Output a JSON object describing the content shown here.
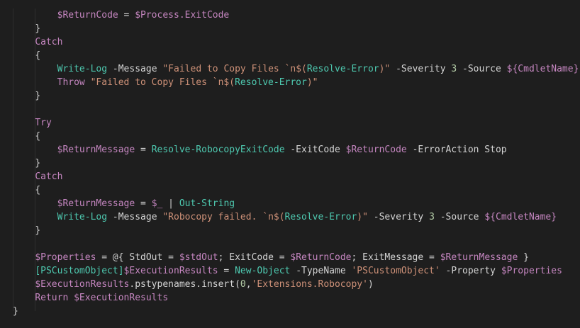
{
  "editor": {
    "colors": {
      "background": "#1e1e1e",
      "variable": "#c586c0",
      "keyword": "#c586c0",
      "function": "#4ec9b0",
      "string": "#ce9178",
      "operator": "#d4d4d4",
      "number": "#b5cea8",
      "plain": "#d4d4d4"
    },
    "lines": [
      {
        "indent": "        ",
        "tokens": [
          {
            "t": "var",
            "v": "$ReturnCode"
          },
          {
            "t": "op",
            "v": " = "
          },
          {
            "t": "var",
            "v": "$Process.ExitCode"
          }
        ]
      },
      {
        "indent": "    ",
        "tokens": [
          {
            "t": "plain",
            "v": "}"
          }
        ]
      },
      {
        "indent": "    ",
        "tokens": [
          {
            "t": "kw",
            "v": "Catch"
          }
        ]
      },
      {
        "indent": "    ",
        "tokens": [
          {
            "t": "plain",
            "v": "{"
          }
        ]
      },
      {
        "indent": "        ",
        "tokens": [
          {
            "t": "fn",
            "v": "Write-Log"
          },
          {
            "t": "plain",
            "v": " "
          },
          {
            "t": "op",
            "v": "-Message"
          },
          {
            "t": "plain",
            "v": " "
          },
          {
            "t": "str",
            "v": "\"Failed to Copy Files `n$("
          },
          {
            "t": "fn",
            "v": "Resolve-Error"
          },
          {
            "t": "str",
            "v": ")\""
          },
          {
            "t": "plain",
            "v": " "
          },
          {
            "t": "op",
            "v": "-Severity"
          },
          {
            "t": "plain",
            "v": " "
          },
          {
            "t": "num",
            "v": "3"
          },
          {
            "t": "plain",
            "v": " "
          },
          {
            "t": "op",
            "v": "-Source"
          },
          {
            "t": "plain",
            "v": " "
          },
          {
            "t": "var",
            "v": "${CmdletName}"
          }
        ]
      },
      {
        "indent": "        ",
        "tokens": [
          {
            "t": "kw",
            "v": "Throw"
          },
          {
            "t": "plain",
            "v": " "
          },
          {
            "t": "str",
            "v": "\"Failed to Copy Files `n$("
          },
          {
            "t": "fn",
            "v": "Resolve-Error"
          },
          {
            "t": "str",
            "v": ")\""
          }
        ]
      },
      {
        "indent": "    ",
        "tokens": [
          {
            "t": "plain",
            "v": "}"
          }
        ]
      },
      {
        "indent": "",
        "tokens": []
      },
      {
        "indent": "    ",
        "tokens": [
          {
            "t": "kw",
            "v": "Try"
          }
        ]
      },
      {
        "indent": "    ",
        "tokens": [
          {
            "t": "plain",
            "v": "{"
          }
        ]
      },
      {
        "indent": "        ",
        "tokens": [
          {
            "t": "var",
            "v": "$ReturnMessage"
          },
          {
            "t": "op",
            "v": " = "
          },
          {
            "t": "fn",
            "v": "Resolve-RobocopyExitCode"
          },
          {
            "t": "plain",
            "v": " "
          },
          {
            "t": "op",
            "v": "-ExitCode"
          },
          {
            "t": "plain",
            "v": " "
          },
          {
            "t": "var",
            "v": "$ReturnCode"
          },
          {
            "t": "plain",
            "v": " "
          },
          {
            "t": "op",
            "v": "-ErrorAction"
          },
          {
            "t": "plain",
            "v": " Stop"
          }
        ]
      },
      {
        "indent": "    ",
        "tokens": [
          {
            "t": "plain",
            "v": "}"
          }
        ]
      },
      {
        "indent": "    ",
        "tokens": [
          {
            "t": "kw",
            "v": "Catch"
          }
        ]
      },
      {
        "indent": "    ",
        "tokens": [
          {
            "t": "plain",
            "v": "{"
          }
        ]
      },
      {
        "indent": "        ",
        "tokens": [
          {
            "t": "var",
            "v": "$ReturnMessage"
          },
          {
            "t": "op",
            "v": " = "
          },
          {
            "t": "var",
            "v": "$_"
          },
          {
            "t": "plain",
            "v": " "
          },
          {
            "t": "op",
            "v": "|"
          },
          {
            "t": "plain",
            "v": " "
          },
          {
            "t": "fn",
            "v": "Out-String"
          }
        ]
      },
      {
        "indent": "        ",
        "tokens": [
          {
            "t": "fn",
            "v": "Write-Log"
          },
          {
            "t": "plain",
            "v": " "
          },
          {
            "t": "op",
            "v": "-Message"
          },
          {
            "t": "plain",
            "v": " "
          },
          {
            "t": "str",
            "v": "\"Robocopy failed. `n$("
          },
          {
            "t": "fn",
            "v": "Resolve-Error"
          },
          {
            "t": "str",
            "v": ")\""
          },
          {
            "t": "plain",
            "v": " "
          },
          {
            "t": "op",
            "v": "-Severity"
          },
          {
            "t": "plain",
            "v": " "
          },
          {
            "t": "num",
            "v": "3"
          },
          {
            "t": "plain",
            "v": " "
          },
          {
            "t": "op",
            "v": "-Source"
          },
          {
            "t": "plain",
            "v": " "
          },
          {
            "t": "var",
            "v": "${CmdletName}"
          }
        ]
      },
      {
        "indent": "    ",
        "tokens": [
          {
            "t": "plain",
            "v": "}"
          }
        ]
      },
      {
        "indent": "",
        "tokens": []
      },
      {
        "indent": "    ",
        "tokens": [
          {
            "t": "var",
            "v": "$Properties"
          },
          {
            "t": "op",
            "v": " = "
          },
          {
            "t": "plain",
            "v": "@{ StdOut "
          },
          {
            "t": "op",
            "v": "="
          },
          {
            "t": "plain",
            "v": " "
          },
          {
            "t": "var",
            "v": "$stdOut"
          },
          {
            "t": "plain",
            "v": "; ExitCode "
          },
          {
            "t": "op",
            "v": "="
          },
          {
            "t": "plain",
            "v": " "
          },
          {
            "t": "var",
            "v": "$ReturnCode"
          },
          {
            "t": "plain",
            "v": "; ExitMessage "
          },
          {
            "t": "op",
            "v": "="
          },
          {
            "t": "plain",
            "v": " "
          },
          {
            "t": "var",
            "v": "$ReturnMessage"
          },
          {
            "t": "plain",
            "v": " }"
          }
        ]
      },
      {
        "indent": "    ",
        "tokens": [
          {
            "t": "fn",
            "v": "[PSCustomObject]"
          },
          {
            "t": "var",
            "v": "$ExecutionResults"
          },
          {
            "t": "op",
            "v": " = "
          },
          {
            "t": "fn",
            "v": "New-Object"
          },
          {
            "t": "plain",
            "v": " "
          },
          {
            "t": "op",
            "v": "-TypeName"
          },
          {
            "t": "plain",
            "v": " "
          },
          {
            "t": "str",
            "v": "'PSCustomObject'"
          },
          {
            "t": "plain",
            "v": " "
          },
          {
            "t": "op",
            "v": "-Property"
          },
          {
            "t": "plain",
            "v": " "
          },
          {
            "t": "var",
            "v": "$Properties"
          }
        ]
      },
      {
        "indent": "    ",
        "tokens": [
          {
            "t": "var",
            "v": "$ExecutionResults"
          },
          {
            "t": "plain",
            "v": ".pstypenames.insert("
          },
          {
            "t": "num",
            "v": "0"
          },
          {
            "t": "plain",
            "v": ","
          },
          {
            "t": "str",
            "v": "'Extensions.Robocopy'"
          },
          {
            "t": "plain",
            "v": ")"
          }
        ]
      },
      {
        "indent": "    ",
        "tokens": [
          {
            "t": "kw",
            "v": "Return"
          },
          {
            "t": "plain",
            "v": " "
          },
          {
            "t": "var",
            "v": "$ExecutionResults"
          }
        ]
      },
      {
        "indent": "",
        "tokens": [
          {
            "t": "plain",
            "v": "}"
          }
        ]
      }
    ]
  }
}
